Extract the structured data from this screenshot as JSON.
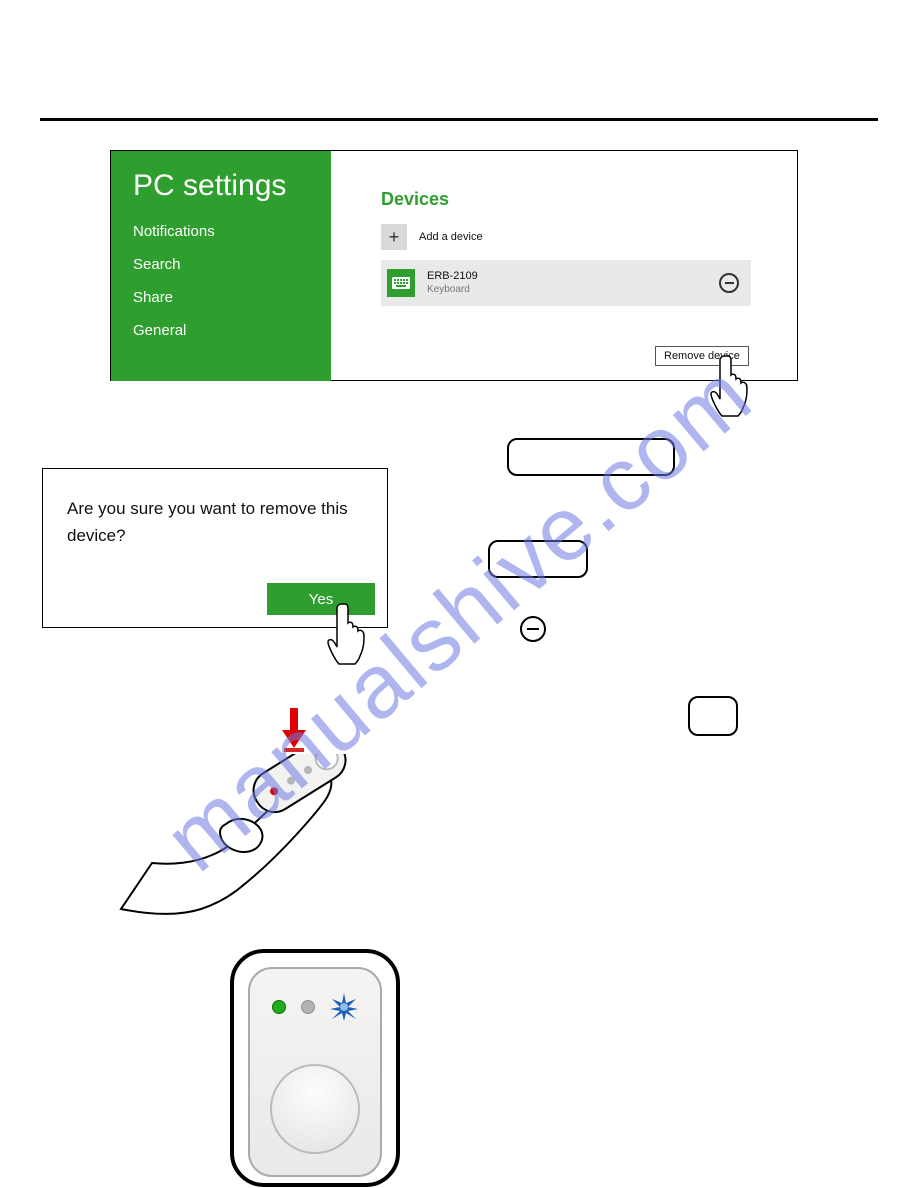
{
  "watermark": "manualshive.com",
  "pc_settings": {
    "title": "PC settings",
    "sidebar_items": [
      "Notifications",
      "Search",
      "Share",
      "General"
    ]
  },
  "devices": {
    "heading": "Devices",
    "add_label": "Add a device",
    "items": [
      {
        "name": "ERB-2109",
        "kind": "Keyboard"
      }
    ],
    "remove_tooltip": "Remove device"
  },
  "confirm": {
    "message": "Are you sure you want to remove this device?",
    "yes": "Yes"
  }
}
